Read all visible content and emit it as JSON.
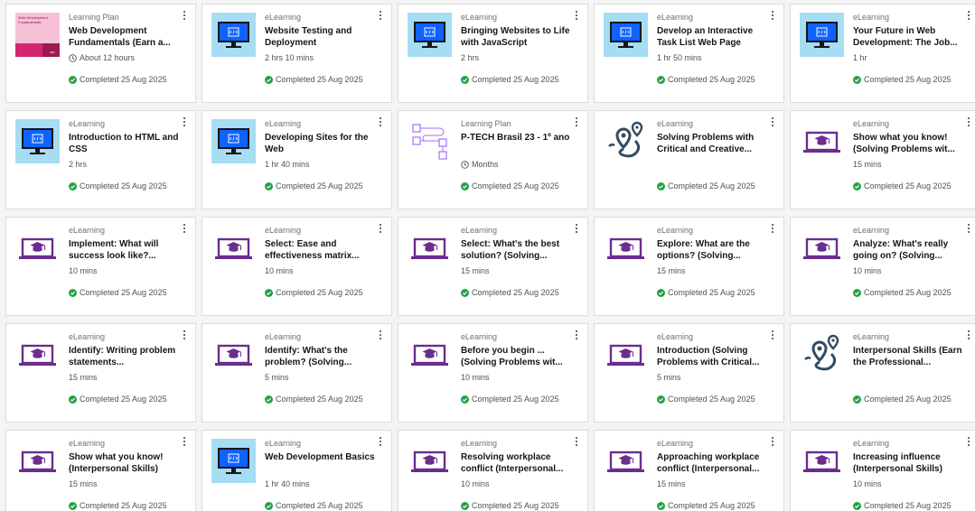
{
  "common": {
    "completed": "Completed 25 Aug 2025",
    "icons": {
      "menu": "overflow-menu-icon",
      "check": "checkmark-circle-icon",
      "clock": "clock-icon"
    },
    "colors": {
      "completed_green": "#24a148",
      "purple_icon": "#6b2d8e",
      "navy_icon": "#324b61",
      "monitor_bg": "#a6dcf4"
    }
  },
  "cards": [
    {
      "type": "Learning Plan",
      "title": "Web Development Fundamentals (Earn a...",
      "duration": "About 12 hours",
      "status": "Completed 25 Aug 2025",
      "thumb": "cover",
      "cover_title": "Web Development Fundamentals",
      "cover_brand": "IBM",
      "clock": true
    },
    {
      "type": "eLearning",
      "title": "Website Testing and Deployment",
      "duration": "2 hrs 10 mins",
      "status": "Completed 25 Aug 2025",
      "thumb": "monitor"
    },
    {
      "type": "eLearning",
      "title": "Bringing Websites to Life with JavaScript",
      "duration": "2 hrs",
      "status": "Completed 25 Aug 2025",
      "thumb": "monitor"
    },
    {
      "type": "eLearning",
      "title": "Develop an Interactive Task List Web Page",
      "duration": "1 hr 50 mins",
      "status": "Completed 25 Aug 2025",
      "thumb": "monitor"
    },
    {
      "type": "eLearning",
      "title": "Your Future in Web Development: The Job...",
      "duration": "1 hr",
      "status": "Completed 25 Aug 2025",
      "thumb": "monitor"
    },
    {
      "type": "eLearning",
      "title": "Introduction to HTML and CSS",
      "duration": "2 hrs",
      "status": "Completed 25 Aug 2025",
      "thumb": "monitor"
    },
    {
      "type": "eLearning",
      "title": "Developing Sites for the Web",
      "duration": "1 hr 40 mins",
      "status": "Completed 25 Aug 2025",
      "thumb": "monitor"
    },
    {
      "type": "Learning Plan",
      "title": "P-TECH Brasil 23 - 1º ano",
      "duration": "Months",
      "status": "Completed 25 Aug 2025",
      "thumb": "plan",
      "clock": true
    },
    {
      "type": "eLearning",
      "title": "Solving Problems with Critical and Creative...",
      "duration": "",
      "status": "Completed 25 Aug 2025",
      "thumb": "map"
    },
    {
      "type": "eLearning",
      "title": "Show what you know! (Solving Problems wit...",
      "duration": "15 mins",
      "status": "Completed 25 Aug 2025",
      "thumb": "grad"
    },
    {
      "type": "eLearning",
      "title": "Implement: What will success look like?...",
      "duration": "10 mins",
      "status": "Completed 25 Aug 2025",
      "thumb": "grad"
    },
    {
      "type": "eLearning",
      "title": "Select: Ease and effectiveness matrix...",
      "duration": "10 mins",
      "status": "Completed 25 Aug 2025",
      "thumb": "grad"
    },
    {
      "type": "eLearning",
      "title": "Select: What's the best solution? (Solving...",
      "duration": "15 mins",
      "status": "Completed 25 Aug 2025",
      "thumb": "grad"
    },
    {
      "type": "eLearning",
      "title": "Explore: What are the options? (Solving...",
      "duration": "15 mins",
      "status": "Completed 25 Aug 2025",
      "thumb": "grad"
    },
    {
      "type": "eLearning",
      "title": "Analyze: What's really going on? (Solving...",
      "duration": "10 mins",
      "status": "Completed 25 Aug 2025",
      "thumb": "grad"
    },
    {
      "type": "eLearning",
      "title": "Identify: Writing problem statements...",
      "duration": "15 mins",
      "status": "Completed 25 Aug 2025",
      "thumb": "grad"
    },
    {
      "type": "eLearning",
      "title": "Identify: What's the problem? (Solving...",
      "duration": "5 mins",
      "status": "Completed 25 Aug 2025",
      "thumb": "grad"
    },
    {
      "type": "eLearning",
      "title": "Before you begin ... (Solving Problems wit...",
      "duration": "10 mins",
      "status": "Completed 25 Aug 2025",
      "thumb": "grad"
    },
    {
      "type": "eLearning",
      "title": "Introduction (Solving Problems with Critical...",
      "duration": "5 mins",
      "status": "Completed 25 Aug 2025",
      "thumb": "grad"
    },
    {
      "type": "eLearning",
      "title": "Interpersonal Skills (Earn the Professional...",
      "duration": "",
      "status": "Completed 25 Aug 2025",
      "thumb": "map"
    },
    {
      "type": "eLearning",
      "title": "Show what you know! (Interpersonal Skills)",
      "duration": "15 mins",
      "status": "Completed 25 Aug 2025",
      "thumb": "grad"
    },
    {
      "type": "eLearning",
      "title": "Web Development Basics",
      "duration": "1 hr 40 mins",
      "status": "Completed 25 Aug 2025",
      "thumb": "monitor"
    },
    {
      "type": "eLearning",
      "title": "Resolving workplace conflict (Interpersonal...",
      "duration": "10 mins",
      "status": "Completed 25 Aug 2025",
      "thumb": "grad"
    },
    {
      "type": "eLearning",
      "title": "Approaching workplace conflict (Interpersonal...",
      "duration": "15 mins",
      "status": "Completed 25 Aug 2025",
      "thumb": "grad"
    },
    {
      "type": "eLearning",
      "title": "Increasing influence (Interpersonal Skills)",
      "duration": "10 mins",
      "status": "Completed 25 Aug 2025",
      "thumb": "grad"
    }
  ]
}
